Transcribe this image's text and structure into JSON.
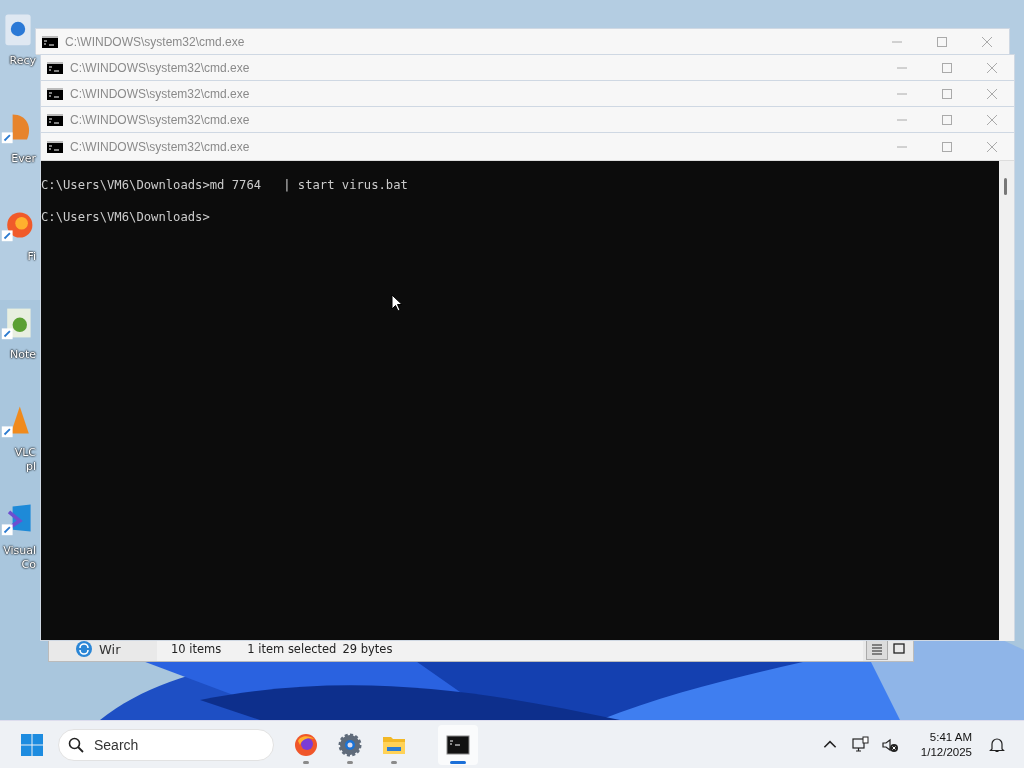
{
  "desktop_icons": [
    {
      "kind": "recycle",
      "label_lines": [
        "Recy"
      ]
    },
    {
      "kind": "note",
      "label_lines": [
        "Ever"
      ]
    },
    {
      "kind": "browser",
      "label_lines": [
        "Fi"
      ]
    },
    {
      "kind": "notepad",
      "label_lines": [
        "Note"
      ]
    },
    {
      "kind": "cone",
      "label_lines": [
        "VLC",
        "pl"
      ]
    },
    {
      "kind": "code",
      "label_lines": [
        "Visual",
        "Co"
      ]
    }
  ],
  "windows": [
    {
      "title": "C:\\WINDOWS\\system32\\cmd.exe"
    },
    {
      "title": "C:\\WINDOWS\\system32\\cmd.exe"
    },
    {
      "title": "C:\\WINDOWS\\system32\\cmd.exe"
    },
    {
      "title": "C:\\WINDOWS\\system32\\cmd.exe"
    },
    {
      "title": "C:\\WINDOWS\\system32\\cmd.exe"
    }
  ],
  "console": {
    "lines": [
      "C:\\Users\\VM6\\Downloads>md 7764   | start virus.bat",
      "C:\\Users\\VM6\\Downloads>"
    ]
  },
  "explorer": {
    "title": "Wir",
    "item_count": "10 items",
    "selection": "1 item selected",
    "size": "29 bytes"
  },
  "taskbar": {
    "search": {
      "placeholder": "Search"
    },
    "apps": [
      {
        "kind": "firefox",
        "selected": false
      },
      {
        "kind": "settings",
        "selected": false
      },
      {
        "kind": "folder",
        "selected": false
      },
      {
        "kind": "terminal",
        "selected": true
      }
    ],
    "time": "5:41 AM",
    "date": "1/12/2025"
  }
}
